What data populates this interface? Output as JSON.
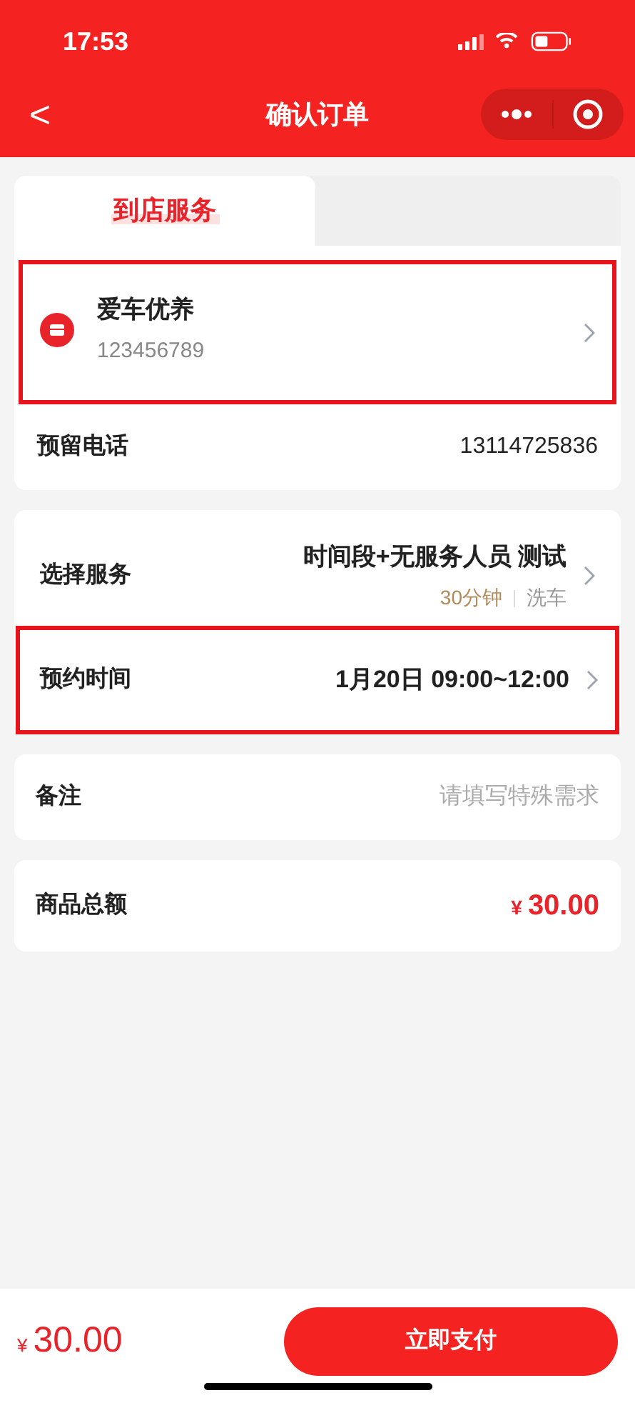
{
  "status_bar": {
    "time": "17:53"
  },
  "nav": {
    "title": "确认订单",
    "back": "<"
  },
  "tabs": [
    {
      "label": "到店服务",
      "selected": true
    }
  ],
  "store": {
    "name": "爱车优养",
    "code": "123456789",
    "highlighted": true
  },
  "phone": {
    "label": "预留电话",
    "value": "13114725836"
  },
  "service": {
    "label": "选择服务",
    "name": "时间段+无服务人员 测试",
    "duration": "30分钟",
    "category": "洗车",
    "highlighted": false
  },
  "appointment": {
    "label": "预约时间",
    "value": "1月20日 09:00~12:00",
    "highlighted": true
  },
  "remark": {
    "label": "备注",
    "placeholder": "请填写特殊需求"
  },
  "total": {
    "label": "商品总额",
    "currency": "¥",
    "amount": "30.00"
  },
  "footer": {
    "currency": "¥",
    "amount": "30.00",
    "pay_button": "立即支付"
  }
}
